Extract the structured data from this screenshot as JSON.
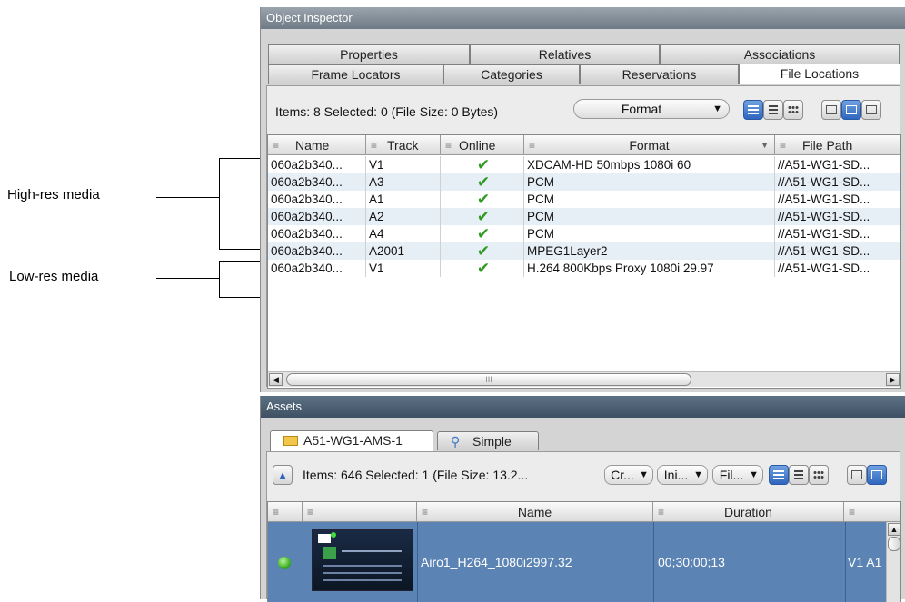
{
  "annotations": {
    "high_res": "High-res media",
    "low_res": "Low-res media"
  },
  "object_inspector": {
    "title": "Object Inspector",
    "tabs_row1": [
      "Properties",
      "Relatives",
      "Associations"
    ],
    "tabs_row2": [
      "Frame Locators",
      "Categories",
      "Reservations",
      "File Locations"
    ],
    "active_tab": "File Locations",
    "status": "Items: 8 Selected: 0 (File Size: 0 Bytes)",
    "format_combo": "Format",
    "columns": [
      "Name",
      "Track",
      "Online",
      "Format",
      "File Path"
    ],
    "rows": [
      {
        "name": "060a2b340...",
        "track": "V1",
        "online": true,
        "format": "XDCAM-HD 50mbps 1080i 60",
        "path": "//A51-WG1-SD..."
      },
      {
        "name": "060a2b340...",
        "track": "A3",
        "online": true,
        "format": "PCM",
        "path": "//A51-WG1-SD..."
      },
      {
        "name": "060a2b340...",
        "track": "A1",
        "online": true,
        "format": "PCM",
        "path": "//A51-WG1-SD..."
      },
      {
        "name": "060a2b340...",
        "track": "A2",
        "online": true,
        "format": "PCM",
        "path": "//A51-WG1-SD..."
      },
      {
        "name": "060a2b340...",
        "track": "A4",
        "online": true,
        "format": "PCM",
        "path": "//A51-WG1-SD..."
      },
      {
        "name": "060a2b340...",
        "track": "A2001",
        "online": true,
        "format": "MPEG1Layer2",
        "path": "//A51-WG1-SD..."
      },
      {
        "name": "060a2b340...",
        "track": "V1",
        "online": true,
        "format": "H.264 800Kbps Proxy 1080i 29.97",
        "path": "//A51-WG1-SD..."
      }
    ],
    "scroll_thumb": "III"
  },
  "assets": {
    "title": "Assets",
    "tabs": [
      "A51-WG1-AMS-1",
      "Simple"
    ],
    "status": "Items: 646 Selected: 1 (File Size: 13.2...",
    "combos": [
      "Cr...",
      "Ini...",
      "Fil..."
    ],
    "columns": [
      "",
      "",
      "Name",
      "Duration",
      ""
    ],
    "row": {
      "name": "Airo1_H264_1080i2997.32",
      "duration": "00;30;00;13",
      "tracks": "V1 A1"
    }
  }
}
